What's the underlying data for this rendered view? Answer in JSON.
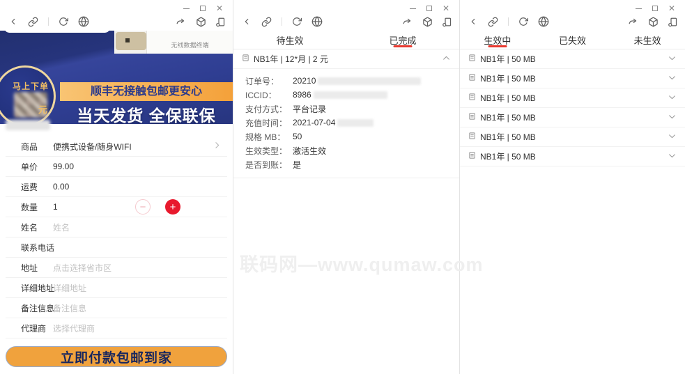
{
  "colors": {
    "accent_red": "#e8392f",
    "banner_blue": "#2c3a8e",
    "band_orange": "#f4a13a",
    "button_orange": "#f0a23d",
    "plus_red": "#e8192d"
  },
  "watermark": "联码网—www.qumaw.com",
  "left": {
    "banner": {
      "ribbon": "马上下单",
      "price_unit": "元",
      "promo_line1": "顺丰无接触包邮更安心",
      "promo_line2": "当天发货 全保联保",
      "product_caption": "无线数据终端"
    },
    "form_rows": [
      {
        "label": "商品",
        "value": "便携式设备/随身WIFI",
        "link": true
      },
      {
        "label": "单价",
        "value": "99.00"
      },
      {
        "label": "运费",
        "value": "0.00"
      },
      {
        "label": "数量",
        "value": "1",
        "stepper": true
      },
      {
        "label": "姓名",
        "placeholder": "姓名"
      },
      {
        "label": "联系电话",
        "placeholder": ""
      },
      {
        "label": "地址",
        "placeholder": "点击选择省市区"
      },
      {
        "label": "详细地址",
        "placeholder": "详细地址"
      },
      {
        "label": "备注信息",
        "placeholder": "备注信息"
      },
      {
        "label": "代理商",
        "placeholder": "选择代理商"
      }
    ],
    "stepper": {
      "minus": "−",
      "plus": "+"
    },
    "pay_button_label": "立即付款包邮到家"
  },
  "middle": {
    "tabs": [
      {
        "label": "待生效",
        "active": false
      },
      {
        "label": "已完成",
        "active": true
      }
    ],
    "order_title": "NB1年 | 12*月 | 2 元",
    "order_details": [
      {
        "label": "订单号：",
        "value": "20210",
        "redacted": true,
        "blur_width": 148
      },
      {
        "label": "ICCID：",
        "value": "8986",
        "redacted": true,
        "blur_width": 106
      },
      {
        "label": "支付方式：",
        "value": "平台记录"
      },
      {
        "label": "充值时间：",
        "value": "2021-07-04",
        "redacted": true,
        "blur_width": 52
      },
      {
        "label": "规格 MB：",
        "value": "50"
      },
      {
        "label": "生效类型：",
        "value": "激活生效"
      },
      {
        "label": "是否到账：",
        "value": "是"
      }
    ]
  },
  "right": {
    "tabs": [
      {
        "label": "生效中",
        "active": true
      },
      {
        "label": "已失效",
        "active": false
      },
      {
        "label": "未生效",
        "active": false
      }
    ],
    "items": [
      {
        "label": "NB1年 | 50 MB"
      },
      {
        "label": "NB1年 | 50 MB"
      },
      {
        "label": "NB1年 | 50 MB"
      },
      {
        "label": "NB1年 | 50 MB"
      },
      {
        "label": "NB1年 | 50 MB"
      },
      {
        "label": "NB1年 | 50 MB"
      }
    ]
  }
}
